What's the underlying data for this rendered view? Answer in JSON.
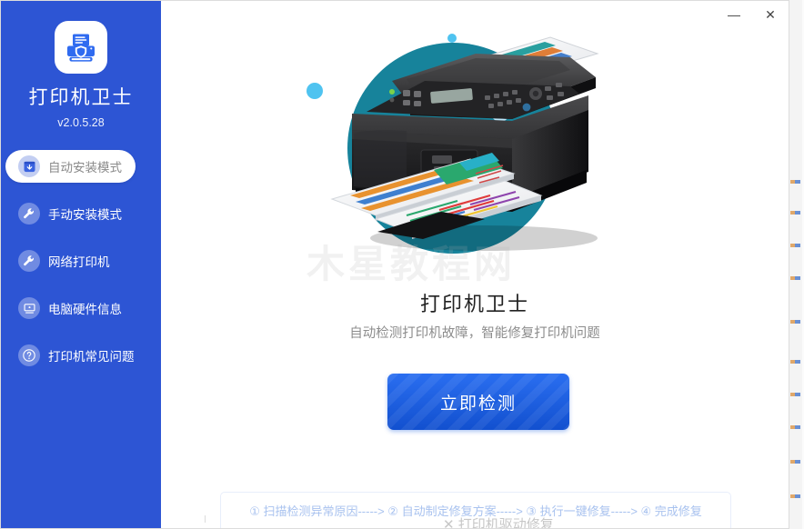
{
  "window": {
    "minimize_label": "—",
    "close_label": "✕"
  },
  "sidebar": {
    "brand_name": "打印机卫士",
    "version": "v2.0.5.28",
    "logo_icon": "printer-shield-icon",
    "items": [
      {
        "label": "自动安装模式",
        "icon": "download-box-icon",
        "active": true
      },
      {
        "label": "手动安装模式",
        "icon": "wrench-icon",
        "active": false
      },
      {
        "label": "网络打印机",
        "icon": "wrench-icon",
        "active": false
      },
      {
        "label": "电脑硬件信息",
        "icon": "monitor-icon",
        "active": false
      },
      {
        "label": "打印机常见问题",
        "icon": "question-mark-icon",
        "active": false
      }
    ]
  },
  "main": {
    "hero_title": "打印机卫士",
    "hero_subtitle": "自动检测打印机故障，智能修复打印机问题",
    "detect_button": "立即检测",
    "watermark": "木星教程网",
    "illustration_icon": "printer-illustration"
  },
  "footer": {
    "steps_text": "① 扫描检测异常原因-----> ② 自动制定修复方案-----> ③ 执行一键修复-----> ④ 完成修复",
    "background_peek_text": "✕ 打印机驱动修复"
  },
  "colors": {
    "sidebar_blue": "#2d55d4",
    "button_blue": "#1a5fe0",
    "teal_blob": "#17839b",
    "dot_blue": "#4fc3f0",
    "steps_text": "#a8c2ef"
  }
}
